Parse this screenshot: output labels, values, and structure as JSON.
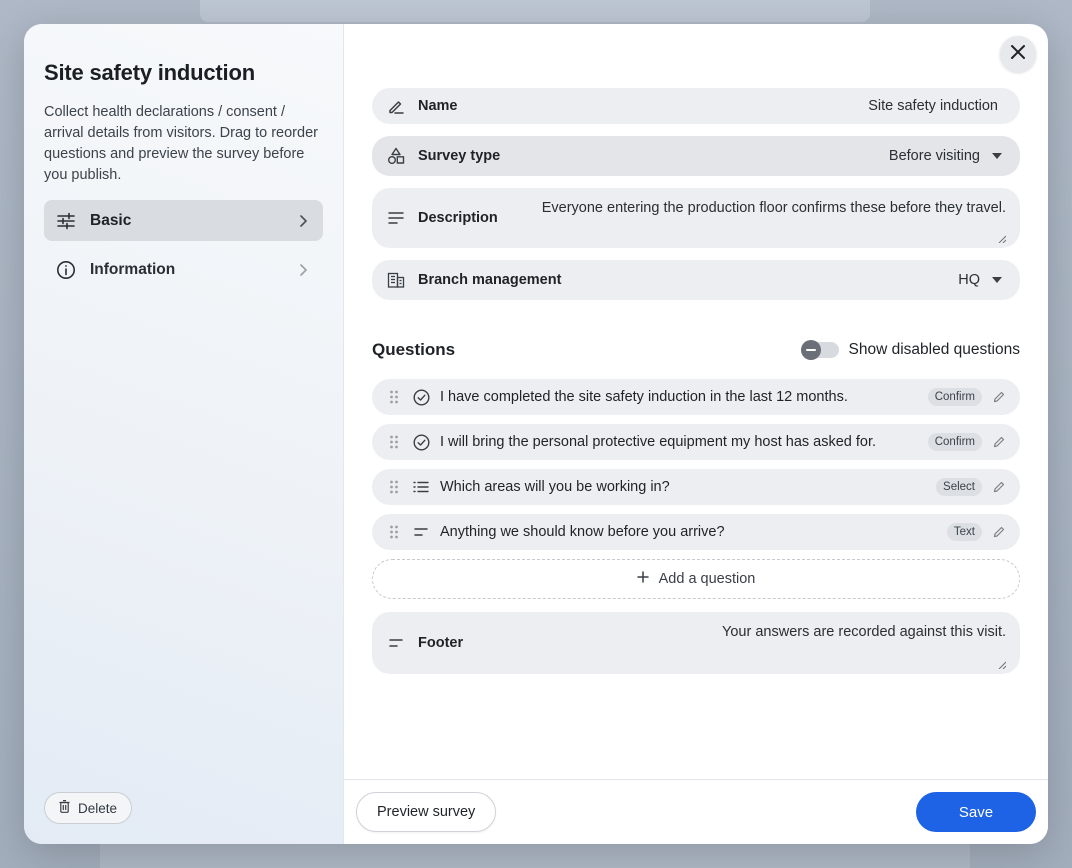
{
  "sidebar": {
    "title": "Site safety induction",
    "description": "Collect health declarations / consent / arrival details from visitors. Drag to reorder questions and preview the survey before you publish.",
    "nav": [
      {
        "label": "Basic",
        "icon": "sliders-icon",
        "active": true
      },
      {
        "label": "Information",
        "icon": "info-icon",
        "active": false
      }
    ],
    "delete_label": "Delete"
  },
  "form": {
    "name": {
      "label": "Name",
      "value": "Site safety induction"
    },
    "survey_type": {
      "label": "Survey type",
      "value": "Before visiting"
    },
    "description": {
      "label": "Description",
      "value": "Everyone entering the production floor confirms these before they travel."
    },
    "branch": {
      "label": "Branch management",
      "value": "HQ"
    }
  },
  "questions": {
    "title": "Questions",
    "toggle_label": "Show disabled questions",
    "items": [
      {
        "text": "I have completed the site safety induction in the last 12 months.",
        "type": "Confirm",
        "icon": "check-circle-icon"
      },
      {
        "text": "I will bring the personal protective equipment my host has asked for.",
        "type": "Confirm",
        "icon": "check-circle-icon"
      },
      {
        "text": "Which areas will you be working in?",
        "type": "Select",
        "icon": "list-icon"
      },
      {
        "text": "Anything we should know before you arrive?",
        "type": "Text",
        "icon": "text-lines-icon"
      }
    ],
    "add_label": "Add a question"
  },
  "footer_field": {
    "label": "Footer",
    "value": "Your answers are recorded against this visit."
  },
  "actions": {
    "preview_label": "Preview survey",
    "save_label": "Save"
  },
  "colors": {
    "primary": "#1e62e6"
  }
}
